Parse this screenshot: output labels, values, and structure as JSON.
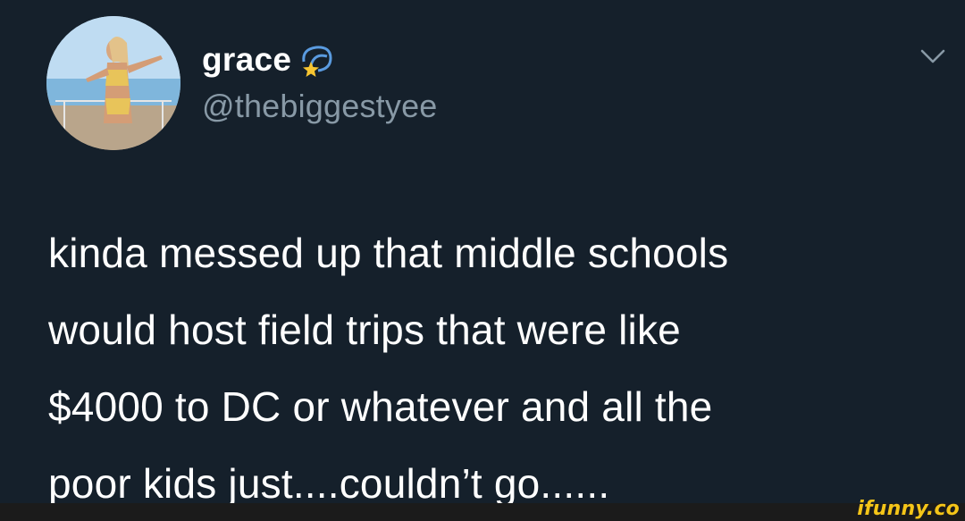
{
  "tweet": {
    "display_name": "grace",
    "name_emoji": "dizzy-star-emoji",
    "handle": "@thebiggestyee",
    "menu_icon": "chevron-down-icon",
    "text_lines": [
      "kinda messed up that middle schools",
      "would host field trips that were like",
      "$4000 to DC or whatever and all the",
      "poor kids just....couldn’t go......"
    ]
  },
  "watermark": {
    "text": "ifunny.co"
  },
  "colors": {
    "background": "#15202b",
    "text_primary": "#ffffff",
    "text_secondary": "#8899a6",
    "watermark": "#f5c518"
  }
}
